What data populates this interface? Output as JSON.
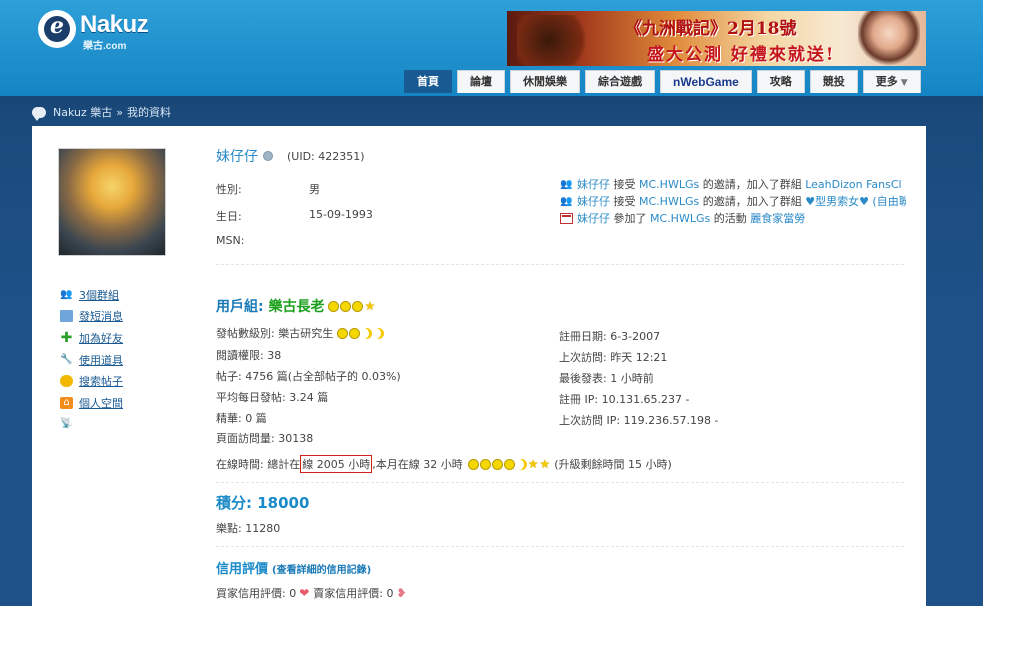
{
  "logo": {
    "mark": "e",
    "name": "Nakuz",
    "sub": "樂古.com"
  },
  "banner": {
    "line1": "《九洲戰記》2月18號",
    "line2": "盛大公測 好禮來就送!"
  },
  "nav": {
    "tabs": [
      {
        "label": "首頁",
        "active": true
      },
      {
        "label": "論壇"
      },
      {
        "label": "休閒娛樂"
      },
      {
        "label": "綜合遊戲"
      },
      {
        "label": "nWebGame"
      },
      {
        "label": "攻略"
      },
      {
        "label": "競投"
      },
      {
        "label": "更多"
      }
    ]
  },
  "breadcrumb": {
    "site": "Nakuz 樂古",
    "sep": "»",
    "page": "我的資料"
  },
  "actions": [
    {
      "label": "3個群組",
      "icon": "group-icon"
    },
    {
      "label": "發短消息",
      "icon": "mail-icon"
    },
    {
      "label": "加為好友",
      "icon": "plus-icon"
    },
    {
      "label": "使用道具",
      "icon": "wrench-icon"
    },
    {
      "label": "搜索帖子",
      "icon": "bubble-icon"
    },
    {
      "label": "個人空間",
      "icon": "home-icon"
    }
  ],
  "profile": {
    "username": "妹仔仔",
    "uid": "(UID: 422351)",
    "gender_label": "性別:",
    "gender": "男",
    "birthday_label": "生日:",
    "birthday": "15-09-1993",
    "msn_label": "MSN:",
    "msn": ""
  },
  "feed": [
    {
      "user": "妹仔仔",
      "t1": " 接受 ",
      "who": "MC.HWLGs",
      "t2": " 的邀請，加入了群組 ",
      "target": "LeahDizon FansCl",
      "t3": ""
    },
    {
      "user": "妹仔仔",
      "t1": " 接受 ",
      "who": "MC.HWLGs",
      "t2": " 的邀請，加入了群組 ",
      "target": "♥型男索女♥",
      "t3": " (自由聯盟"
    },
    {
      "user": "妹仔仔",
      "t1": " 參加了 ",
      "who": "MC.HWLGs",
      "t2": " 的活動 ",
      "target": "麗食家當勞",
      "t3": ""
    }
  ],
  "group": {
    "prefix": "用戶組: ",
    "name": "樂古長老"
  },
  "stats_left": {
    "post_level": "發帖數級別: 樂古研究生",
    "read_perm": "閱讀權限: 38",
    "posts": "帖子: 4756 篇(占全部帖子的 0.03%)",
    "daily": "平均每日發帖: 3.24 篇",
    "digest": "精華: 0 篇",
    "views": "頁面訪問量: 30138"
  },
  "stats_right": {
    "reg_date": "註冊日期: 6-3-2007",
    "last_visit": "上次訪問: 昨天 12:21",
    "last_post": "最後發表: 1 小時前",
    "reg_ip": "註冊 IP: 10.131.65.237 -",
    "last_ip": "上次訪問 IP: 119.236.57.198 -"
  },
  "online": {
    "prefix": "在線時間: 總計在",
    "boxed": "線 2005 小時",
    "month": ",本月在線 32 小時",
    "upgrade": "(升級剩餘時間 15 小時)"
  },
  "credits": "積分: 18000",
  "honey": "樂點: 11280",
  "reputation": {
    "title": "信用評價",
    "detail": "(查看詳細的信用記錄)",
    "buyer": "買家信用評價: 0",
    "seller": "賣家信用評價: 0"
  }
}
